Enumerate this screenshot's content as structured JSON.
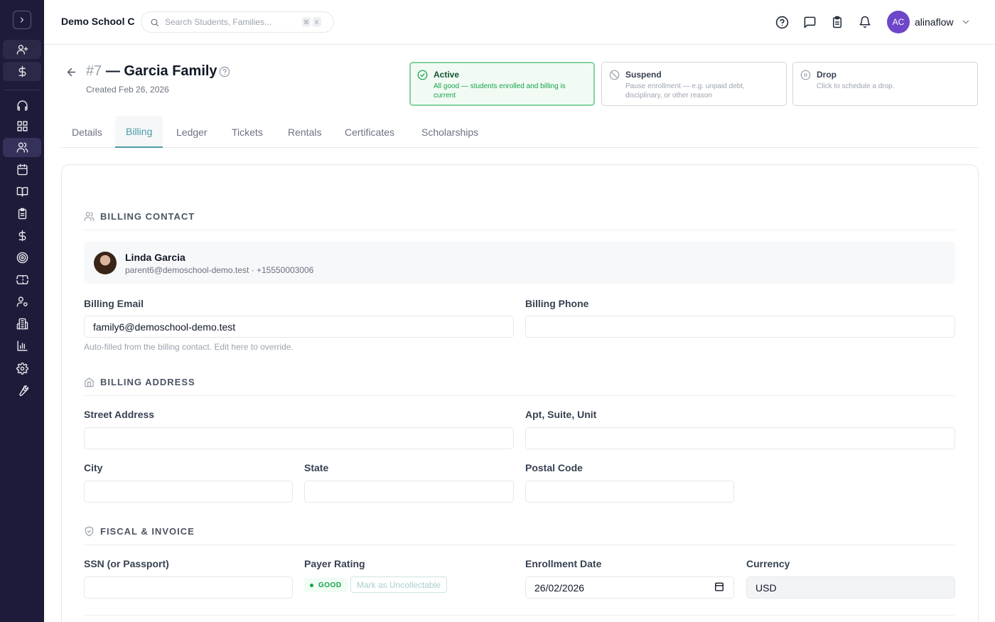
{
  "sidebar": {
    "items": [
      {
        "icon": "user-plus-icon"
      },
      {
        "icon": "dollar-icon"
      },
      {
        "icon": "headphones-icon"
      },
      {
        "icon": "dashboard-icon"
      },
      {
        "icon": "users-icon"
      },
      {
        "icon": "calendar-icon"
      },
      {
        "icon": "book-icon"
      },
      {
        "icon": "clipboard-icon"
      },
      {
        "icon": "dollar-icon"
      },
      {
        "icon": "target-icon"
      },
      {
        "icon": "ticket-icon"
      },
      {
        "icon": "user-gear-icon"
      },
      {
        "icon": "building-icon"
      },
      {
        "icon": "bar-chart-icon"
      },
      {
        "icon": "settings-icon"
      },
      {
        "icon": "wrench-icon"
      }
    ]
  },
  "topbar": {
    "school_name": "Demo School C",
    "search_placeholder": "Search Students, Families...",
    "shortcut_keys": [
      "⌘",
      "K"
    ],
    "avatar_initials": "AC",
    "username": "alinaflow"
  },
  "header": {
    "family_number": "#7",
    "family_name": "— Garcia Family",
    "created": "Created Feb 26, 2026"
  },
  "status_cards": [
    {
      "title": "Active",
      "description": "All good — students enrolled and billing is current",
      "selected": true
    },
    {
      "title": "Suspend",
      "description": "Pause enrollment — e.g. unpaid debt, disciplinary, or other reason",
      "selected": false
    },
    {
      "title": "Drop",
      "description": "Click to schedule a drop.",
      "selected": false
    }
  ],
  "tabs": [
    "Details",
    "Billing",
    "Ledger",
    "Tickets",
    "Rentals",
    "Certificates",
    "Scholarships"
  ],
  "active_tab": "Billing",
  "billing_contact": {
    "heading": "BILLING CONTACT",
    "name": "Linda Garcia",
    "info": "parent6@demoschool-demo.test · +15550003006"
  },
  "billing_fields": {
    "email_label": "Billing Email",
    "email_value": "family6@demoschool-demo.test",
    "email_help": "Auto-filled from the billing contact. Edit here to override.",
    "phone_label": "Billing Phone",
    "phone_value": ""
  },
  "billing_address": {
    "heading": "BILLING ADDRESS",
    "street_label": "Street Address",
    "apt_label": "Apt, Suite, Unit",
    "city_label": "City",
    "state_label": "State",
    "postal_label": "Postal Code"
  },
  "fiscal": {
    "heading": "FISCAL & INVOICE",
    "ssn_label": "SSN (or Passport)",
    "payer_rating_label": "Payer Rating",
    "payer_rating_value": "GOOD",
    "uncollectable_button": "Mark as Uncollectable",
    "enrollment_date_label": "Enrollment Date",
    "enrollment_date_value": "26/02/2026",
    "currency_label": "Currency",
    "currency_value": "USD"
  },
  "colors": {
    "sidebar_bg": "#1e1b3a",
    "accent": "#4a9aa8",
    "active_green": "#16a34a",
    "avatar": "#6d46c9"
  }
}
